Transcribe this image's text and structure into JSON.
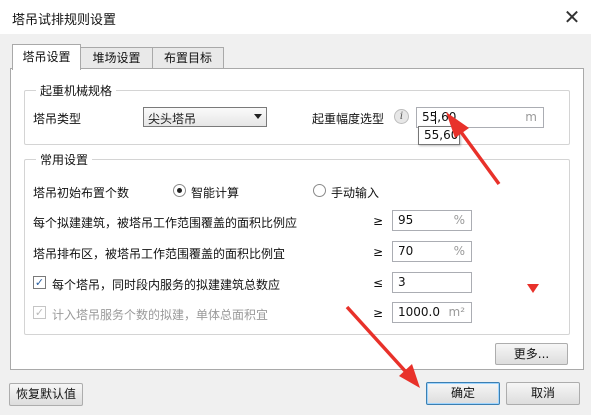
{
  "window": {
    "title": "塔吊试排规则设置",
    "close_glyph": "✕"
  },
  "tabs": [
    {
      "label": "塔吊设置",
      "active": true
    },
    {
      "label": "堆场设置",
      "active": false
    },
    {
      "label": "布置目标",
      "active": false
    }
  ],
  "spec": {
    "legend": "起重机械规格",
    "type_label": "塔吊类型",
    "type_value": "尖头塔吊",
    "range_label": "起重幅度选型",
    "range_info": "i",
    "range_value": "55,60",
    "range_unit": "m",
    "range_suggestion": "55,60"
  },
  "common": {
    "legend": "常用设置",
    "init_label": "塔吊初始布置个数",
    "radio_smart": "智能计算",
    "radio_manual": "手动输入",
    "radio_selected": "smart",
    "cover_building_label": "每个拟建建筑，被塔吊工作范围覆盖的面积比例应",
    "cover_building_op": "≥",
    "cover_building_value": "95",
    "cover_building_unit": "%",
    "cover_area_label": "塔吊排布区，被塔吊工作范围覆盖的面积比例宜",
    "cover_area_op": "≥",
    "cover_area_value": "70",
    "cover_area_unit": "%",
    "serve_label": "每个塔吊，同时段内服务的拟建建筑总数应",
    "serve_checked": true,
    "serve_op": "≤",
    "serve_value": "3",
    "count_label": "计入塔吊服务个数的拟建，单体总面积宜",
    "count_checked": true,
    "count_enabled": false,
    "count_op": "≥",
    "count_value": "1000.0",
    "count_unit": "m²",
    "more_button": "更多..."
  },
  "footer": {
    "restore_button": "恢复默认值",
    "ok_button": "确定",
    "cancel_button": "取消"
  },
  "annotations": {
    "arrow_color": "#e8312a"
  }
}
